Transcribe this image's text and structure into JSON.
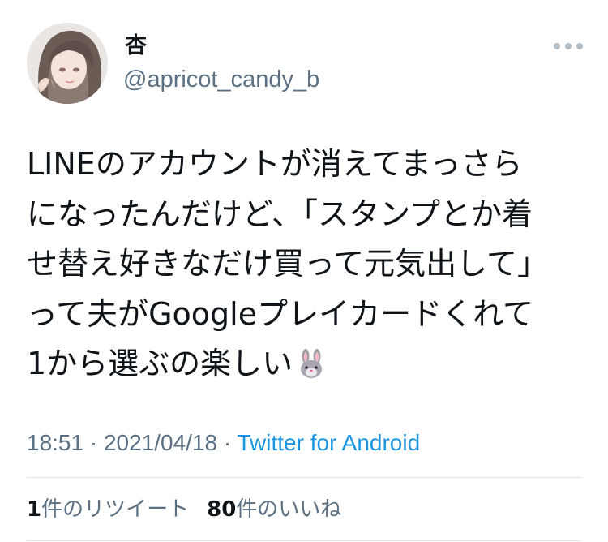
{
  "author": {
    "display_name": "杏",
    "handle": "@apricot_candy_b"
  },
  "tweet": {
    "lines": [
      "LINEのアカウントが消えてまっさら",
      "になったんだけど、「スタンプとか着",
      "せ替え好きなだけ買って元気出して」",
      "って夫がGoogleプレイカードくれて",
      "1から選ぶの楽しい"
    ],
    "emoji": "rabbit-face-icon"
  },
  "meta": {
    "time": "18:51",
    "separator1": " · ",
    "date": "2021/04/18",
    "separator2": " · ",
    "source": "Twitter for Android"
  },
  "stats": {
    "retweets": {
      "count": "1",
      "label": "件のリツイート"
    },
    "likes": {
      "count": "80",
      "label": "件のいいね"
    }
  },
  "colors": {
    "text": "#0f1419",
    "secondary": "#5b7083",
    "link": "#1b95e0",
    "divider": "#dfe4e8"
  }
}
